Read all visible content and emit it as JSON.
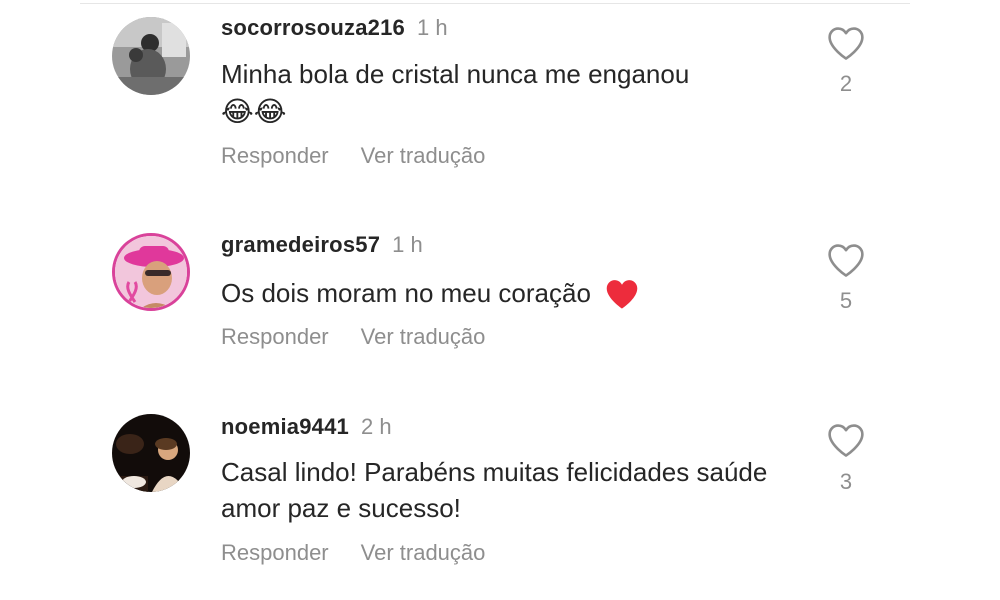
{
  "comments": [
    {
      "username": "socorrosouza216",
      "time": "1 h",
      "text": "Minha bola de cristal nunca me enganou",
      "emoji": "😂😂",
      "reply_label": "Responder",
      "translate_label": "Ver tradução",
      "likes": "2"
    },
    {
      "username": "gramedeiros57",
      "time": "1 h",
      "text": "Os dois moram no meu coração",
      "emoji": "❤️",
      "reply_label": "Responder",
      "translate_label": "Ver tradução",
      "likes": "5"
    },
    {
      "username": "noemia9441",
      "time": "2 h",
      "text": "Casal lindo! Parabéns muitas felicidades saúde amor paz e sucesso!",
      "reply_label": "Responder",
      "translate_label": "Ver tradução",
      "likes": "3"
    }
  ],
  "colors": {
    "text": "#262626",
    "muted": "#8e8e8e",
    "heart_red": "#ed2c3c",
    "divider": "#e6e6e6"
  }
}
